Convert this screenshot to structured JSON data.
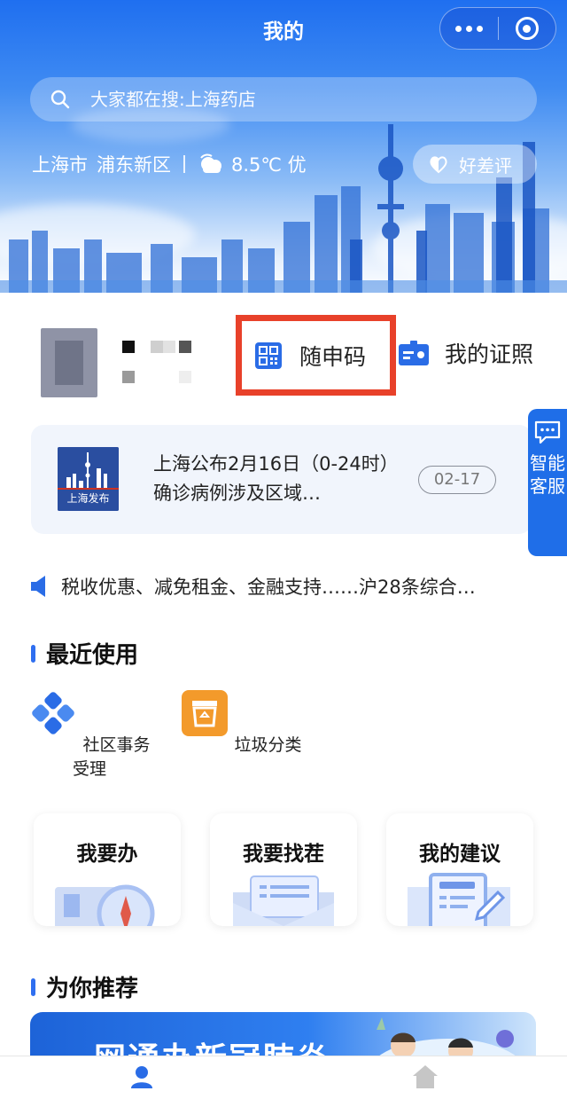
{
  "nav": {
    "title": "我的",
    "more_icon": "more-dots-icon",
    "close_icon": "circle-close-icon"
  },
  "search": {
    "placeholder": "大家都在搜:上海药店"
  },
  "location": {
    "city": "上海市",
    "district": "浦东新区",
    "weather": "8.5℃ 优",
    "review_label": "好差评"
  },
  "profile": {
    "qr_label": "随申码",
    "license_label": "我的证照"
  },
  "news": {
    "logo_text": "上海发布",
    "text": "上海公布2月16日（0-24时）确诊病例涉及区域…",
    "date": "02-17"
  },
  "assistant": {
    "label": "智能客服"
  },
  "notice": {
    "text": "税收优惠、减免租金、金融支持……沪28条综合…"
  },
  "recent": {
    "title": "最近使用",
    "items": [
      {
        "label": "社区事务受理",
        "icon": "community-affairs-icon"
      },
      {
        "label": "垃圾分类",
        "icon": "garbage-sort-icon"
      }
    ]
  },
  "actions": [
    {
      "label": "我要办"
    },
    {
      "label": "我要找茬"
    },
    {
      "label": "我的建议"
    }
  ],
  "recommend": {
    "title": "为你推荐",
    "banner_text": "一网通办新冠肺炎"
  },
  "colors": {
    "primary": "#1f6ee8",
    "highlight": "#e8412a",
    "accent_orange": "#f39a2b"
  }
}
